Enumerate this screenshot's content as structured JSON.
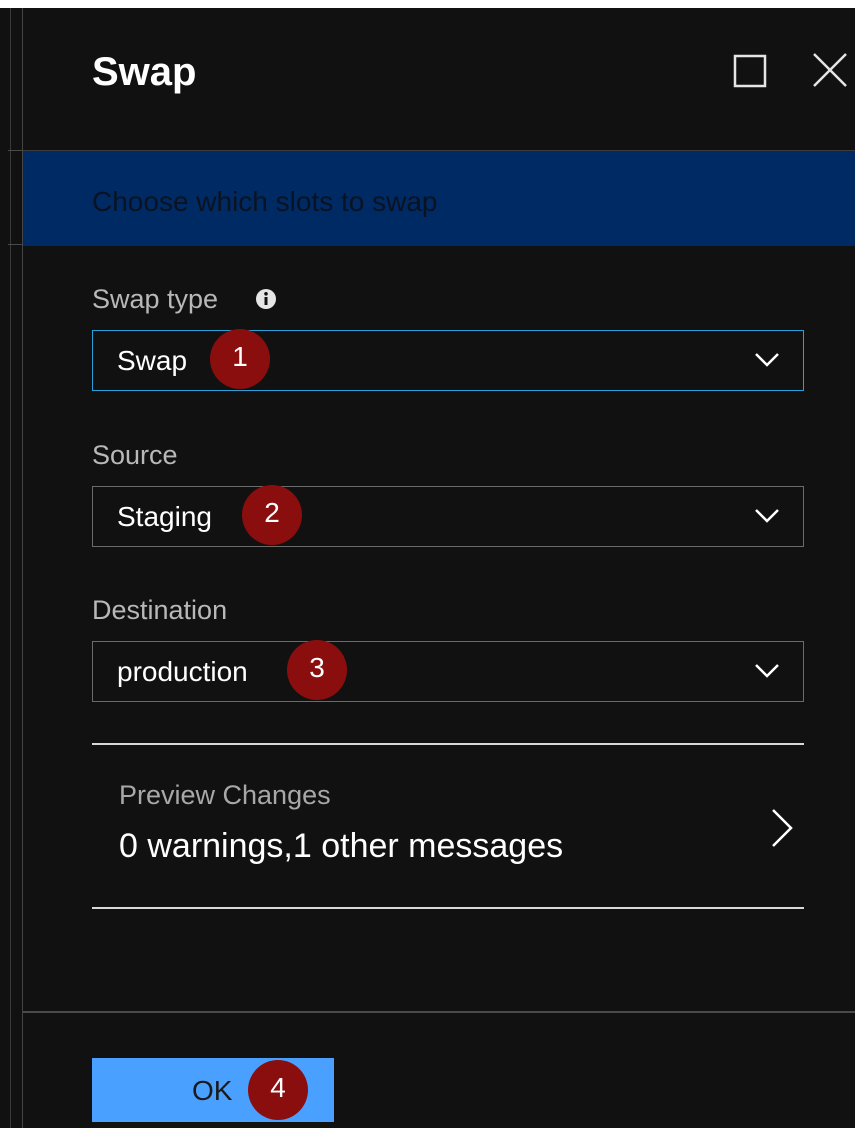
{
  "blade": {
    "title": "Swap",
    "banner_text": "Choose which slots to swap"
  },
  "icons": {
    "maximize": "maximize-icon",
    "close": "close-icon",
    "info": "info-icon",
    "chevron_down": "chevron-down-icon",
    "chevron_right": "chevron-right-icon"
  },
  "fields": {
    "swap_type": {
      "label": "Swap type",
      "value": "Swap",
      "badge": "1"
    },
    "source": {
      "label": "Source",
      "value": "Staging",
      "badge": "2"
    },
    "destination": {
      "label": "Destination",
      "value": "production",
      "badge": "3"
    }
  },
  "preview": {
    "label": "Preview Changes",
    "summary": "0 warnings,1 other messages"
  },
  "footer": {
    "ok_label": "OK",
    "badge": "4"
  },
  "colors": {
    "panel_bg": "#111111",
    "banner_bg": "#002a63",
    "focus_border": "#2aa0d8",
    "primary_button": "#4aa0ff",
    "badge_bg": "#8b0e0e"
  }
}
